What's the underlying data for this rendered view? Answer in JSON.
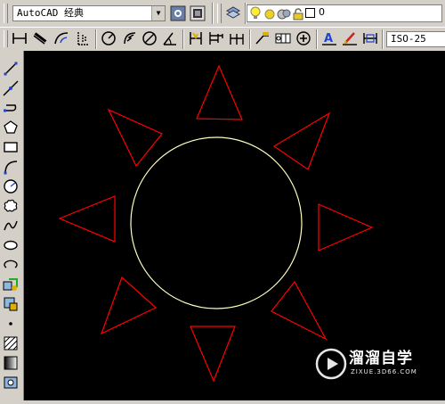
{
  "toolbar_top": {
    "workspace_value": "AutoCAD 经典",
    "layer_value": "0",
    "icons": [
      "workspace-settings-icon",
      "customize-icon",
      "layer-manager-icon",
      "lightbulb-icon",
      "sun-icon",
      "freeze-icon",
      "lock-icon",
      "color-swatch-icon"
    ]
  },
  "toolbar_dim": {
    "dimstyle_value": "ISO-25",
    "icons": [
      "linear-dimension-icon",
      "aligned-dimension-icon",
      "arc-length-icon",
      "ordinate-icon",
      "radius-icon",
      "jogged-icon",
      "diameter-icon",
      "angular-icon",
      "quick-dimension-icon",
      "baseline-icon",
      "continue-icon",
      "quick-leader-icon",
      "tolerance-icon",
      "center-mark-icon",
      "dimension-edit-icon",
      "dimension-text-edit-icon",
      "dimension-update-icon"
    ]
  },
  "draw_toolbar": {
    "icons": [
      "line-icon",
      "construction-line-icon",
      "polyline-icon",
      "polygon-icon",
      "rectangle-icon",
      "arc-icon",
      "circle-icon",
      "revision-cloud-icon",
      "spline-icon",
      "ellipse-icon",
      "ellipse-arc-icon",
      "insert-block-icon",
      "make-block-icon",
      "point-icon",
      "hatch-icon",
      "gradient-icon",
      "region-icon"
    ]
  },
  "watermark": {
    "title": "溜溜自学",
    "subtitle": "ZIXUE.3D66.COM"
  },
  "colors": {
    "canvas": "#000000",
    "triangles": "#ff0000",
    "circle": "#ffffc0",
    "toolbar": "#d4d0c8"
  }
}
